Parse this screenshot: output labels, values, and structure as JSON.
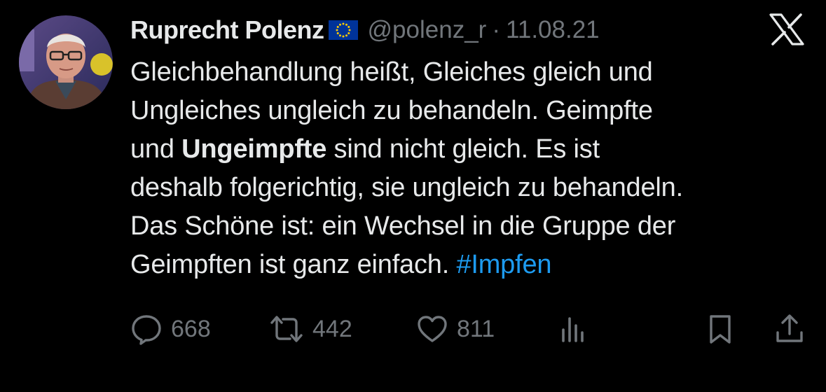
{
  "author": {
    "name": "Ruprecht Polenz",
    "handle": "@polenz_r",
    "separator": "·",
    "date": "11.08.21"
  },
  "tweet": {
    "lines": {
      "l1": "Gleichbehandlung heißt, Gleiches gleich und",
      "l2": "Ungleiches ungleich zu behandeln. Geimpfte",
      "l3_a": "und ",
      "l3_bold": "Ungeimpfte",
      "l3_b": " sind nicht gleich. Es ist",
      "l4": "deshalb folgerichtig, sie ungleich zu behandeln.",
      "l5": "Das Schöne ist: ein Wechsel in die Gruppe der",
      "l6_a": "Geimpften ist ganz einfach. ",
      "l6_hashtag": "#Impfen"
    }
  },
  "actions": {
    "replies": "668",
    "reposts": "442",
    "likes": "811"
  },
  "icons": {
    "flag": "eu-flag-icon",
    "platform": "x-logo-icon",
    "reply": "reply-icon",
    "repost": "repost-icon",
    "like": "heart-icon",
    "views": "views-icon",
    "bookmark": "bookmark-icon",
    "share": "share-icon"
  },
  "colors": {
    "background": "#000000",
    "text": "#e7e9ea",
    "muted": "#71767b",
    "hashtag": "#1d9bf0",
    "flag_blue": "#003399",
    "flag_stars": "#ffcc00"
  }
}
